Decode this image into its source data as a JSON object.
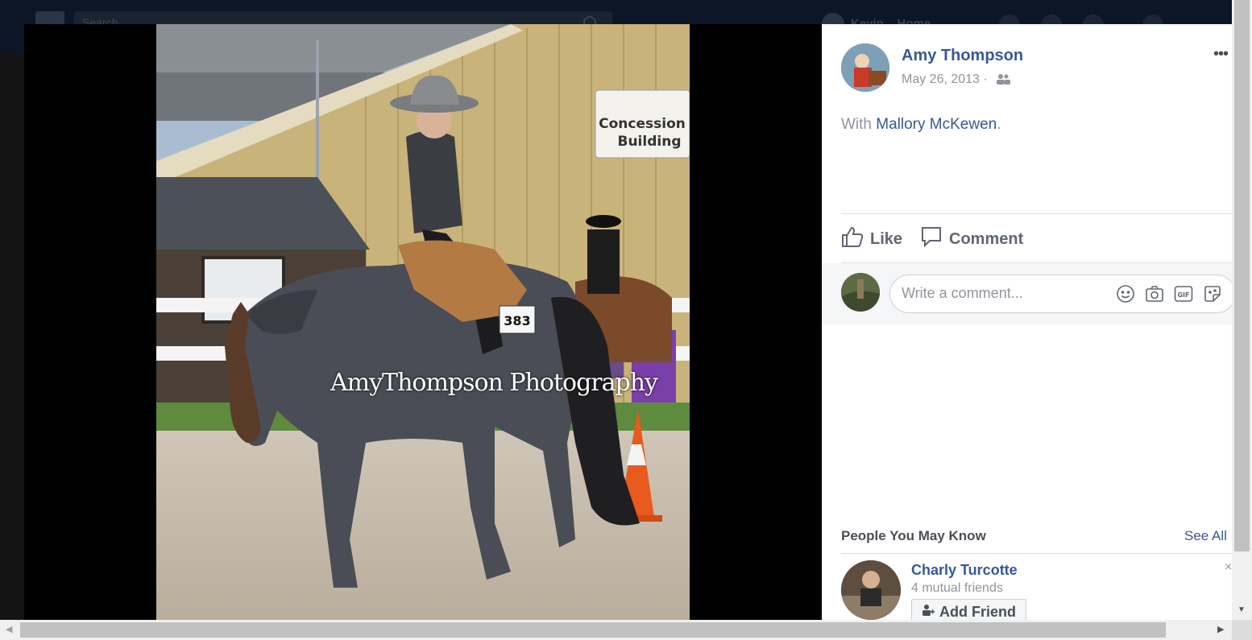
{
  "topbar": {
    "search_placeholder": "Search",
    "user_name": "Kevin",
    "home_label": "Home"
  },
  "photo": {
    "watermark": "AmyThompson Photography",
    "sign_text": "Concession Building",
    "bib_number": "383"
  },
  "post": {
    "author": "Amy Thompson",
    "date": "May 26, 2013 ·",
    "privacy_icon": "friends-icon",
    "with_prefix": "With ",
    "tagged_name": "Mallory McKewen",
    "with_suffix": ".",
    "more_label": "•••"
  },
  "actions": {
    "like_label": "Like",
    "comment_label": "Comment"
  },
  "comment": {
    "placeholder": "Write a comment...",
    "icons": [
      "emoji-icon",
      "camera-icon",
      "gif-icon",
      "sticker-icon"
    ],
    "gif_text": "GIF"
  },
  "pymk": {
    "title": "People You May Know",
    "see_all": "See All",
    "person": {
      "name": "Charly Turcotte",
      "mutual": "4 mutual friends",
      "add_label": "Add Friend"
    },
    "dismiss_label": "×"
  },
  "colors": {
    "link": "#385898",
    "muted": "#90949c",
    "backdrop": "#1d1d1d"
  }
}
